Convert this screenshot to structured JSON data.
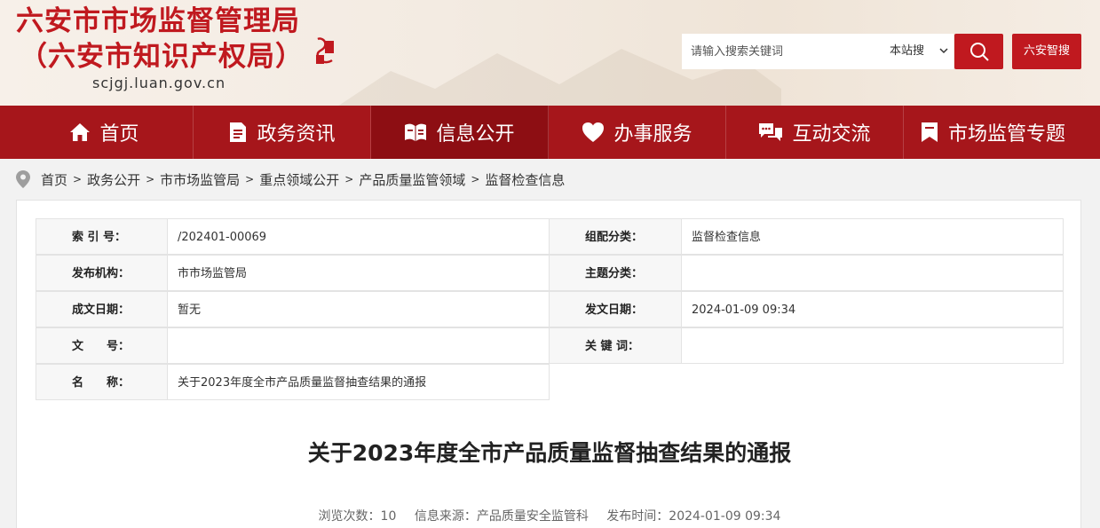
{
  "header": {
    "site_name_line1": "六安市市场监督管理局",
    "site_name_line2": "（六安市知识产权局）",
    "site_domain": "scjgj.luan.gov.cn",
    "search_placeholder": "请输入搜索关键词",
    "search_scope": "本站搜",
    "zhigou_label": "六安智搜"
  },
  "nav": {
    "items": [
      {
        "label": "首页",
        "icon": "home-icon"
      },
      {
        "label": "政务资讯",
        "icon": "document-icon"
      },
      {
        "label": "信息公开",
        "icon": "open-book-icon"
      },
      {
        "label": "办事服务",
        "icon": "heart-icon"
      },
      {
        "label": "互动交流",
        "icon": "chat-icon"
      },
      {
        "label": "市场监管专题",
        "icon": "bookmark-icon"
      }
    ],
    "active": "信息公开"
  },
  "breadcrumb": {
    "items": [
      "首页",
      "政务公开",
      "市市场监管局",
      "重点领域公开",
      "产品质量监管领域",
      "监督检查信息"
    ]
  },
  "meta": {
    "index_label": "索 引 号：",
    "index_value": "/202401-00069",
    "category_label": "组配分类：",
    "category_value": "监督检查信息",
    "publisher_label": "发布机构：",
    "publisher_value": "市市场监管局",
    "topic_label": "主题分类：",
    "topic_value": "",
    "date_written_label": "成文日期：",
    "date_written_value": "暂无",
    "date_published_label": "发文日期：",
    "date_published_value": "2024-01-09 09:34",
    "doc_no_label": "文　　号：",
    "doc_no_value": "",
    "keywords_label": "关 键 词：",
    "keywords_value": "",
    "name_label": "名　　称：",
    "name_value": "关于2023年度全市产品质量监督抽查结果的通报"
  },
  "article": {
    "title": "关于2023年度全市产品质量监督抽查结果的通报",
    "views": "浏览次数：10",
    "source": "信息来源：产品质量安全监管科",
    "publish_time": "发布时间：2024-01-09 09:34"
  },
  "colors": {
    "brand_red": "#c0191f",
    "nav_bg": "#a6161b",
    "nav_active": "#8d0e13"
  }
}
